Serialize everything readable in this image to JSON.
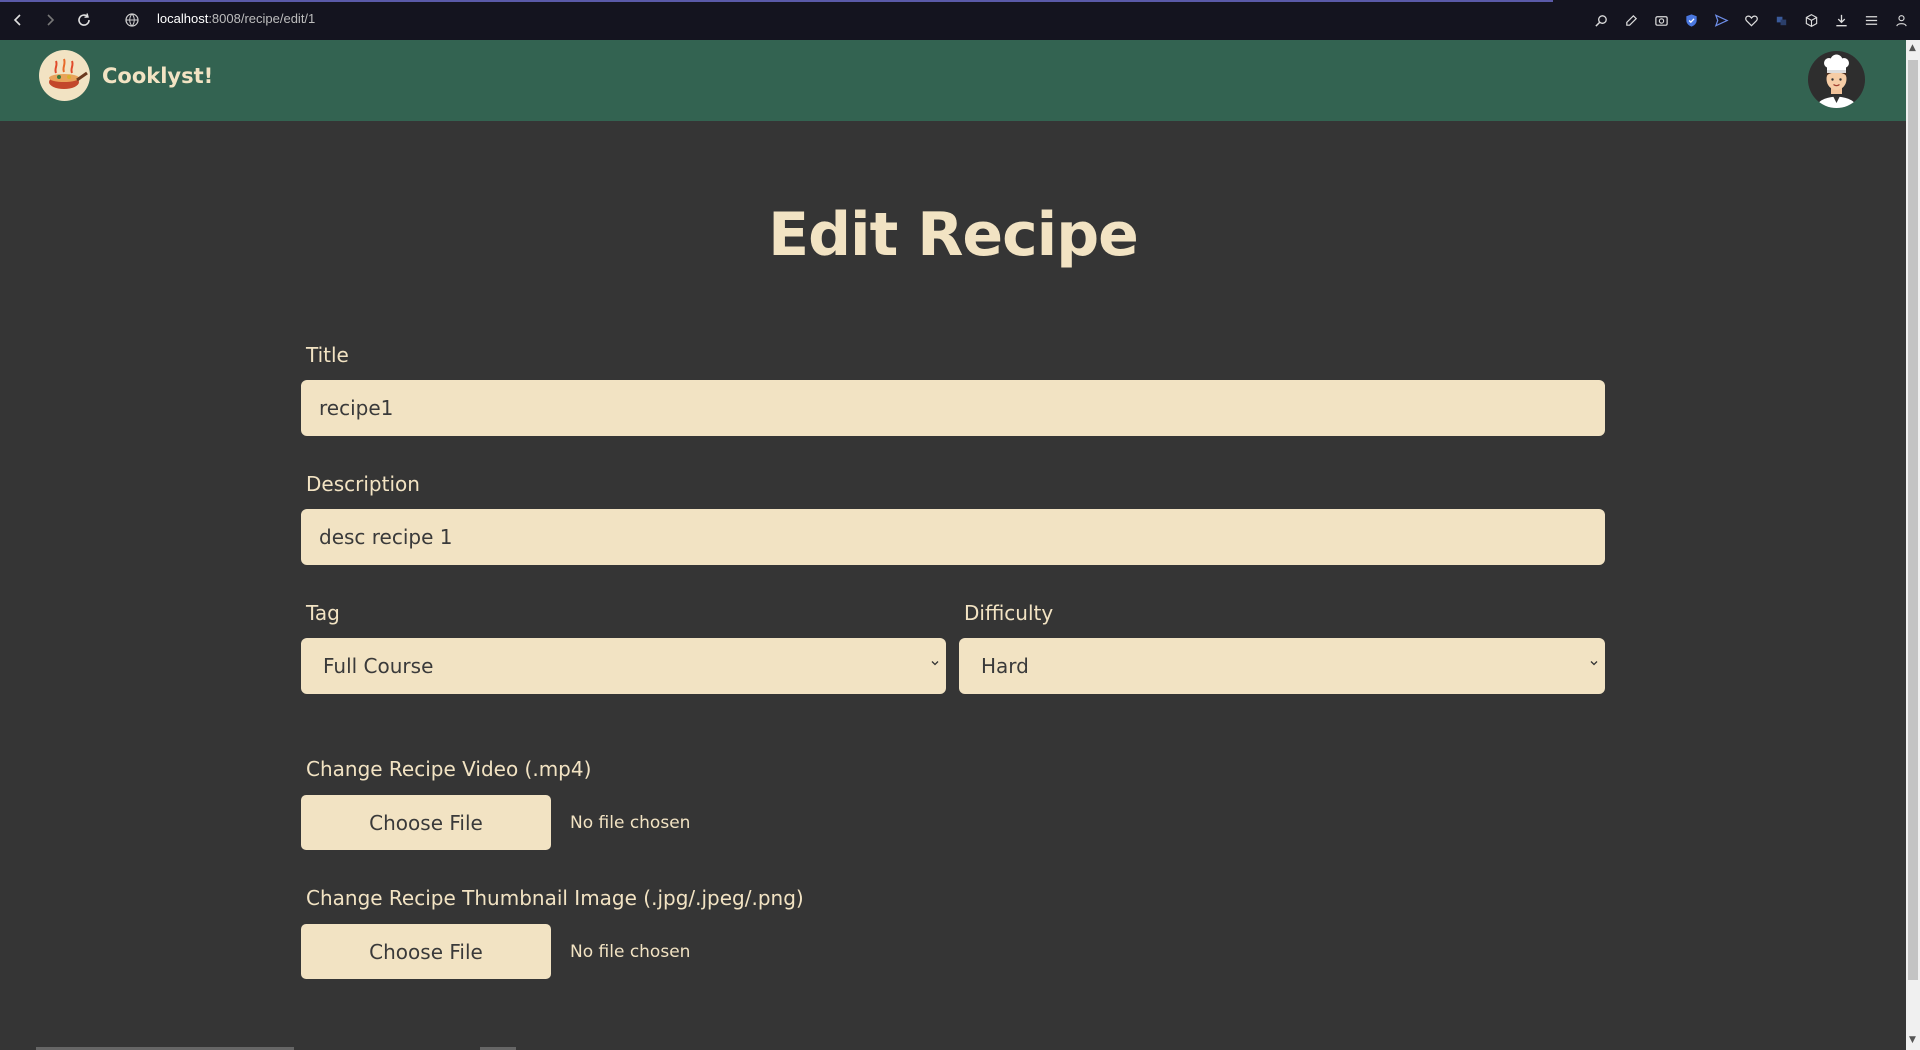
{
  "browser": {
    "url_host": "localhost",
    "url_path": ":8008/recipe/edit/1"
  },
  "header": {
    "brand": "Cooklyst!"
  },
  "page": {
    "title": "Edit Recipe"
  },
  "form": {
    "title_label": "Title",
    "title_value": "recipe1",
    "description_label": "Description",
    "description_value": "desc recipe 1",
    "tag_label": "Tag",
    "tag_value": "Full Course",
    "difficulty_label": "Difficulty",
    "difficulty_value": "Hard",
    "video_label": "Change Recipe Video (.mp4)",
    "video_button": "Choose File",
    "video_status": "No file chosen",
    "thumbnail_label": "Change Recipe Thumbnail Image (.jpg/.jpeg/.png)",
    "thumbnail_button": "Choose File",
    "thumbnail_status": "No file chosen"
  },
  "colors": {
    "background": "#353535",
    "header": "#336351",
    "accent": "#f2e3c3"
  }
}
